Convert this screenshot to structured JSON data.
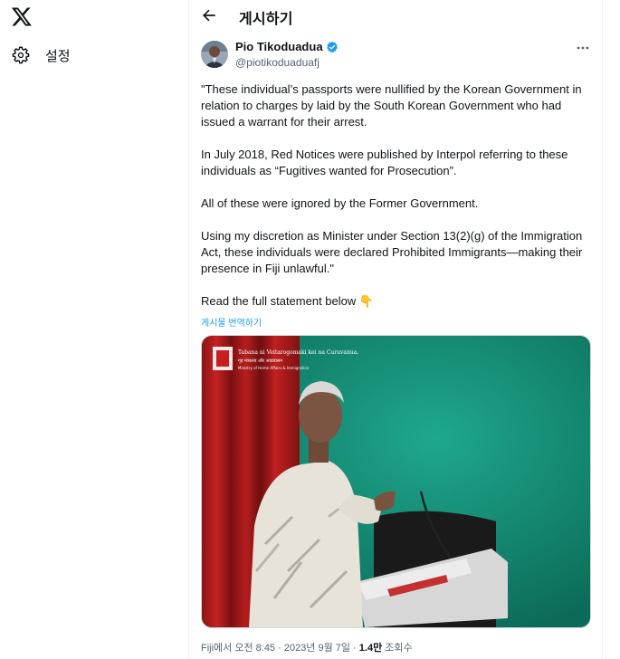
{
  "sidebar": {
    "settings_label": "설정"
  },
  "header": {
    "title": "게시하기"
  },
  "post": {
    "author_name": "Pio Tikoduadua",
    "author_handle": "@piotikoduaduafj",
    "paragraphs": [
      "\"These individual’s passports were nullified by the Korean Government in relation to charges by laid by the South Korean Government who had issued a warrant for their arrest.",
      "In July 2018, Red Notices were published by Interpol referring to these individuals as “Fugitives wanted for Prosecution”.",
      "All of these were ignored by the Former Government.",
      "Using my discretion as Minister under Section 13(2)(g) of the Immigration Act, these individuals were declared Prohibited Immigrants—making their presence in Fiji unlawful.\"",
      "Read the full statement below 👇"
    ],
    "translate_label": "게시물 번역하기",
    "image": {
      "banner_line1": "Tabana ni Veitarogomaki kei na Curuvanua.",
      "banner_line2": "गृह मंत्रालय और आप्रवासन",
      "banner_line3": "Ministry of Home Affairs & Immigration"
    },
    "meta": {
      "prefix": "Fiji에서 오전 8:45 · 2023년 9월 7일 · ",
      "views": "1.4만",
      "views_suffix": " 조회수"
    }
  },
  "colors": {
    "accent": "#1d9bf0",
    "text": "#0f1419",
    "secondary": "#536471"
  },
  "icons": [
    "x-logo-icon",
    "gear-icon",
    "back-arrow-icon",
    "verified-badge-icon",
    "more-icon"
  ]
}
